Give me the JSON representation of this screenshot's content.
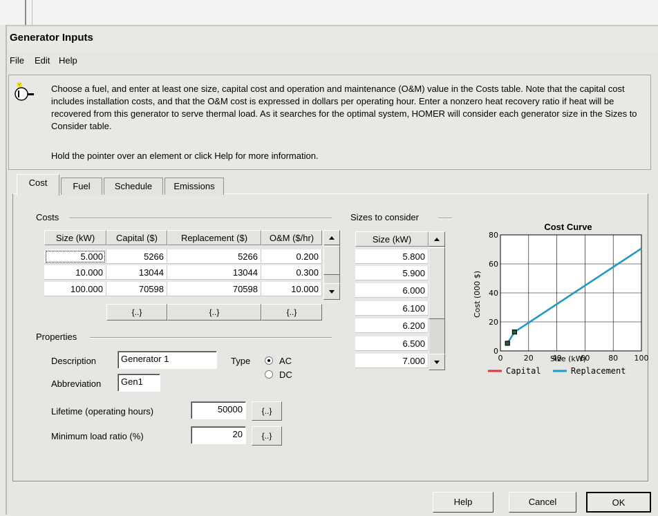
{
  "window": {
    "title": "Generator Inputs"
  },
  "menu": [
    "File",
    "Edit",
    "Help"
  ],
  "info": {
    "text": "Choose a fuel, and enter at least one size, capital cost and operation and maintenance (O&M) value in the Costs table. Note that the capital cost includes installation costs, and that the O&M cost is expressed in dollars per operating hour. Enter a nonzero heat recovery ratio if heat will be recovered from this generator to serve thermal load. As it searches for the optimal system, HOMER will consider each generator size in the Sizes to Consider table.",
    "hint": "Hold the pointer over an element or click Help for more information."
  },
  "tabs": [
    "Cost",
    "Fuel",
    "Schedule",
    "Emissions"
  ],
  "costs": {
    "label": "Costs",
    "headers": [
      "Size (kW)",
      "Capital ($)",
      "Replacement ($)",
      "O&M ($/hr)"
    ],
    "rows": [
      [
        "5.000",
        "5266",
        "5266",
        "0.200"
      ],
      [
        "10.000",
        "13044",
        "13044",
        "0.300"
      ],
      [
        "100.000",
        "70598",
        "70598",
        "10.000"
      ]
    ],
    "button_label": "{..}"
  },
  "sizes": {
    "label": "Sizes to consider",
    "header": "Size (kW)",
    "values": [
      "5.800",
      "5.900",
      "6.000",
      "6.100",
      "6.200",
      "6.500",
      "7.000"
    ]
  },
  "properties": {
    "label": "Properties",
    "description_label": "Description",
    "description_value": "Generator 1",
    "abbreviation_label": "Abbreviation",
    "abbreviation_value": "Gen1",
    "type_label": "Type",
    "type_ac": "AC",
    "type_dc": "DC",
    "lifetime_label": "Lifetime (operating hours)",
    "lifetime_value": "50000",
    "minload_label": "Minimum load ratio (%)",
    "minload_value": "20",
    "button_label": "{..}"
  },
  "chart_data": {
    "type": "line",
    "title": "Cost Curve",
    "xlabel": "Size (kW)",
    "ylabel": "Cost (000 $)",
    "xlim": [
      0,
      100
    ],
    "ylim": [
      0,
      80
    ],
    "xticks": [
      "0",
      "20",
      "40",
      "60",
      "80",
      "100"
    ],
    "yticks": [
      "0",
      "20",
      "40",
      "60",
      "80"
    ],
    "grid": true,
    "legend_position": "bottom",
    "series": [
      {
        "name": "Capital",
        "color": "#d9363e",
        "x": [
          5,
          10,
          100
        ],
        "y": [
          5.266,
          13.044,
          70.598
        ]
      },
      {
        "name": "Replacement",
        "color": "#1aa0c8",
        "x": [
          5,
          10,
          100
        ],
        "y": [
          5.266,
          13.044,
          70.598
        ]
      }
    ]
  },
  "buttons": {
    "help": "Help",
    "cancel": "Cancel",
    "ok": "OK"
  }
}
